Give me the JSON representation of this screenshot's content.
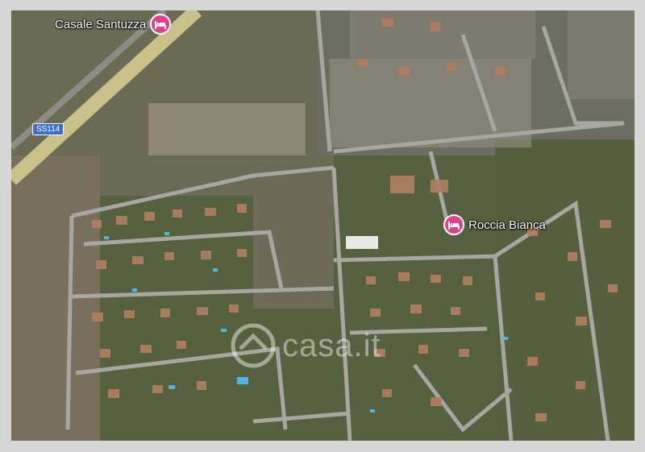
{
  "places": [
    {
      "name": "Casale Santuzza",
      "type": "hotel",
      "icon": "hotel-bed-icon"
    },
    {
      "name": "Roccia Bianca",
      "type": "hotel",
      "icon": "hotel-bed-icon"
    }
  ],
  "road_shield": "SS114",
  "watermark": "casa.it",
  "colors": {
    "marker": "#e0408a",
    "shield": "#3a6fd0",
    "road": "#c9c08a"
  }
}
